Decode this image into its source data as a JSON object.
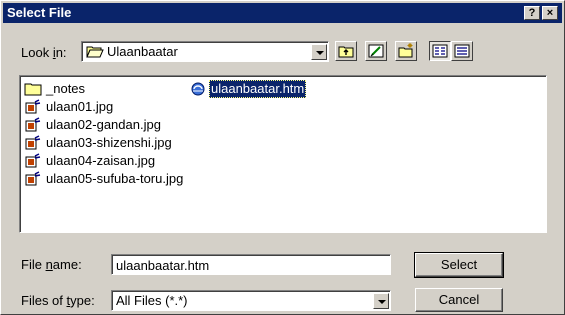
{
  "title": "Select File",
  "lookin": {
    "label_pre": "Look ",
    "label_key": "i",
    "label_post": "n:",
    "value": "Ulaanbaatar"
  },
  "files": [
    {
      "name": "_notes",
      "type": "folder"
    },
    {
      "name": "ulaan01.jpg",
      "type": "image"
    },
    {
      "name": "ulaan02-gandan.jpg",
      "type": "image"
    },
    {
      "name": "ulaan03-shizenshi.jpg",
      "type": "image"
    },
    {
      "name": "ulaan04-zaisan.jpg",
      "type": "image"
    },
    {
      "name": "ulaan05-sufuba-toru.jpg",
      "type": "image"
    },
    {
      "name": "ulaanbaatar.htm",
      "type": "html",
      "selected": true
    }
  ],
  "filename": {
    "label_pre": "File ",
    "label_key": "n",
    "label_post": "ame:",
    "value": "ulaanbaatar.htm"
  },
  "filetype": {
    "label_pre": "Files of ",
    "label_key": "t",
    "label_post": "ype:",
    "value": "All Files (*.*)"
  },
  "buttons": {
    "select": "Select",
    "cancel": "Cancel",
    "help": "?",
    "close": "×"
  }
}
